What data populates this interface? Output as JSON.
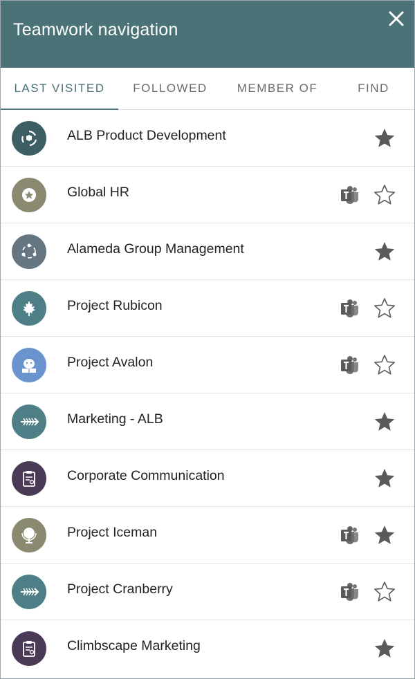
{
  "header": {
    "title": "Teamwork navigation"
  },
  "colors": {
    "header_bg": "#4b7377",
    "accent": "#4b7377",
    "star_filled": "#5a5a5a",
    "star_outline": "#5a5a5a"
  },
  "tabs": [
    {
      "label": "LAST VISITED",
      "active": true
    },
    {
      "label": "FOLLOWED",
      "active": false
    },
    {
      "label": "MEMBER OF",
      "active": false
    },
    {
      "label": "FIND",
      "active": false
    }
  ],
  "sites": [
    {
      "name": "ALB Product Development",
      "icon": "recycle-icon",
      "avatar_color": "#3d5e62",
      "teams": false,
      "followed": true
    },
    {
      "name": "Global HR",
      "icon": "badge-star-icon",
      "avatar_color": "#8a8a70",
      "teams": true,
      "followed": false
    },
    {
      "name": "Alameda Group Management",
      "icon": "people-cycle-icon",
      "avatar_color": "#657680",
      "teams": false,
      "followed": true
    },
    {
      "name": "Project Rubicon",
      "icon": "maple-leaf-icon",
      "avatar_color": "#4f7f86",
      "teams": true,
      "followed": false
    },
    {
      "name": "Project Avalon",
      "icon": "reader-icon",
      "avatar_color": "#6b94cf",
      "teams": true,
      "followed": false
    },
    {
      "name": "Marketing - ALB",
      "icon": "fishbone-icon",
      "avatar_color": "#4f7f86",
      "teams": false,
      "followed": true
    },
    {
      "name": "Corporate Communication",
      "icon": "clipboard-icon",
      "avatar_color": "#4a3a55",
      "teams": false,
      "followed": true
    },
    {
      "name": "Project Iceman",
      "icon": "globe-icon",
      "avatar_color": "#8a8a70",
      "teams": true,
      "followed": true
    },
    {
      "name": "Project Cranberry",
      "icon": "fishbone-icon",
      "avatar_color": "#4f7f86",
      "teams": true,
      "followed": false
    },
    {
      "name": "Climbscape Marketing",
      "icon": "clipboard-icon",
      "avatar_color": "#4a3a55",
      "teams": false,
      "followed": true
    }
  ]
}
